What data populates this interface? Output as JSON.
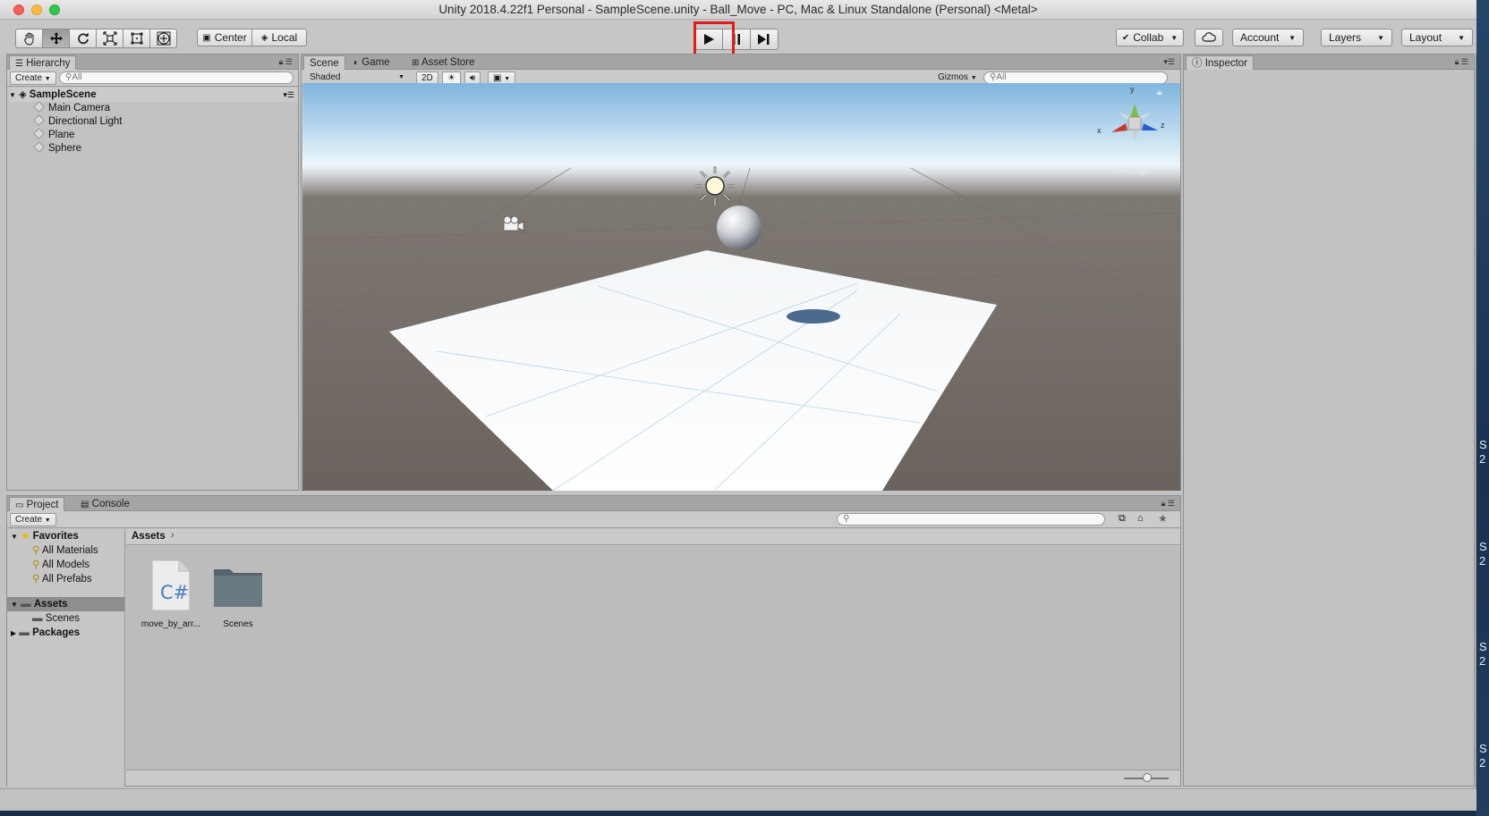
{
  "window": {
    "title": "Unity 2018.4.22f1 Personal - SampleScene.unity - Ball_Move - PC, Mac & Linux Standalone (Personal) <Metal>"
  },
  "toolbar": {
    "tools": [
      "hand-icon",
      "move-icon",
      "rotate-icon",
      "scale-icon",
      "rect-icon",
      "transform-icon"
    ],
    "pivot_label": "Center",
    "space_label": "Local",
    "play_icon": "play-icon",
    "pause_icon": "pause-icon",
    "step_icon": "step-icon",
    "collab_label": "Collab",
    "account_label": "Account",
    "layers_label": "Layers",
    "layout_label": "Layout"
  },
  "hierarchy": {
    "tab_label": "Hierarchy",
    "create_label": "Create",
    "search_placeholder": "All",
    "scene_name": "SampleScene",
    "items": [
      "Main Camera",
      "Directional Light",
      "Plane",
      "Sphere"
    ]
  },
  "scene": {
    "tabs": [
      "Scene",
      "Game",
      "Asset Store"
    ],
    "shading_mode": "Shaded",
    "mode_2d": "2D",
    "gizmos_label": "Gizmos",
    "search_placeholder": "All",
    "persp_label": "Persp",
    "gizmo_axes": [
      "y",
      "x",
      "z"
    ]
  },
  "inspector": {
    "tab_label": "Inspector"
  },
  "project": {
    "tabs": [
      "Project",
      "Console"
    ],
    "create_label": "Create",
    "favorites_label": "Favorites",
    "favorites": [
      "All Materials",
      "All Models",
      "All Prefabs"
    ],
    "assets_label": "Assets",
    "assets_children": [
      "Scenes"
    ],
    "packages_label": "Packages",
    "breadcrumb": "Assets",
    "files": [
      {
        "name": "move_by_arr...",
        "icon": "csharp-script-icon",
        "glyph": "C#"
      },
      {
        "name": "Scenes",
        "icon": "folder-icon"
      }
    ]
  },
  "desktop": {
    "edge_chars": [
      "S",
      "2",
      "S",
      "2",
      "S",
      "2",
      "S",
      "2"
    ]
  },
  "colors": {
    "highlight": "#e21b1b",
    "selection": "#8e8e8e",
    "panel_bg": "#c2c2c2"
  }
}
